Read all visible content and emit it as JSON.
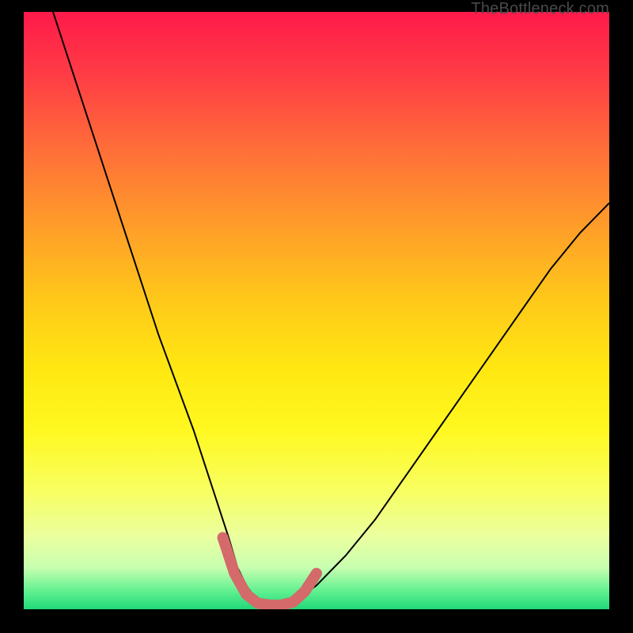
{
  "watermark": "TheBottleneck.com",
  "colors": {
    "background": "#000000",
    "gradient_top": "#ff1a4a",
    "gradient_bottom": "#20d878",
    "curve": "#000000",
    "highlight": "#d46a6a"
  },
  "chart_data": {
    "type": "line",
    "title": "",
    "xlabel": "",
    "ylabel": "",
    "xlim": [
      0,
      100
    ],
    "ylim": [
      0,
      100
    ],
    "grid": false,
    "legend": false,
    "series": [
      {
        "name": "bottleneck-curve",
        "x": [
          5,
          8,
          11,
          14,
          17,
          20,
          23,
          26,
          29,
          31,
          33,
          35,
          36.5,
          38,
          40,
          42,
          44,
          46,
          50,
          55,
          60,
          65,
          70,
          75,
          80,
          85,
          90,
          95,
          100
        ],
        "values": [
          100,
          91,
          82,
          73,
          64,
          55,
          46,
          38,
          30,
          24,
          18,
          12,
          7,
          4,
          1.2,
          0.6,
          0.6,
          1.2,
          4,
          9,
          15,
          22,
          29,
          36,
          43,
          50,
          57,
          63,
          68
        ]
      },
      {
        "name": "highlight-region",
        "x": [
          34,
          36,
          38,
          40,
          42,
          44,
          46,
          48,
          50
        ],
        "values": [
          12,
          6,
          2.5,
          1.0,
          0.7,
          0.7,
          1.2,
          3,
          6
        ]
      }
    ],
    "annotations": []
  }
}
